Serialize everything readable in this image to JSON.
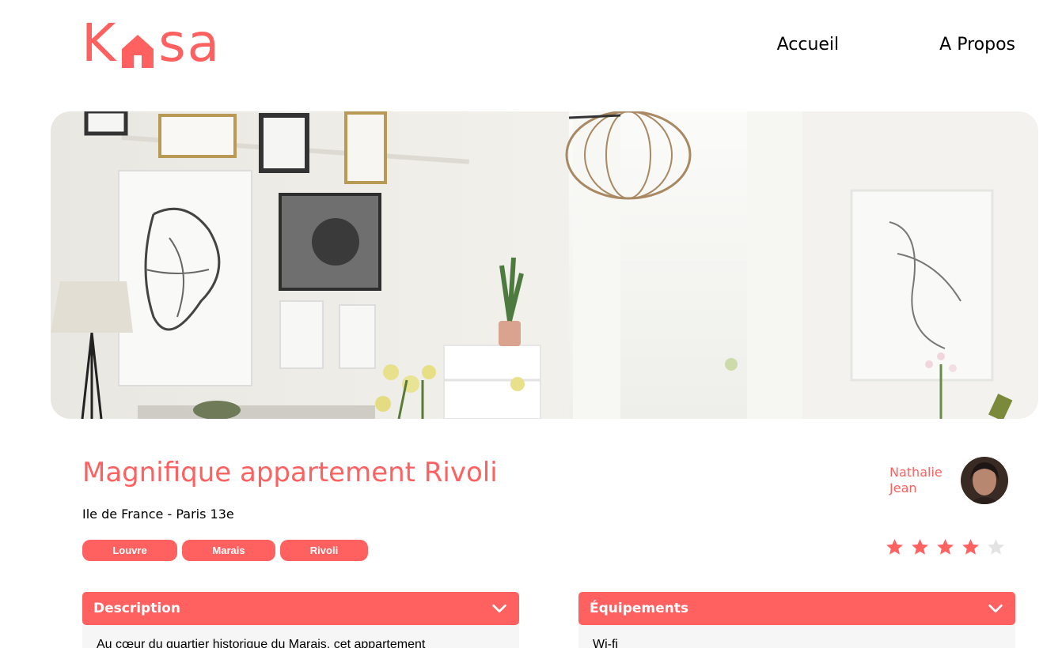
{
  "header": {
    "logo": {
      "letters_left": "K",
      "letters_right": "sa",
      "color": "#FF6060"
    },
    "nav": [
      {
        "label": "Accueil"
      },
      {
        "label": "A Propos"
      }
    ]
  },
  "listing": {
    "title": "Magnifique appartement Rivoli",
    "location": "Ile de France - Paris 13e",
    "tags": [
      "Louvre",
      "Marais",
      "Rivoli"
    ],
    "host": {
      "first_name": "Nathalie",
      "last_name": "Jean"
    },
    "rating": {
      "value": 4,
      "max": 5
    },
    "accent_color": "#FF6060",
    "inactive_star_color": "#E3E3E3"
  },
  "collapses": [
    {
      "title": "Description",
      "body": "Au cœur du quartier historique du Marais, cet appartement"
    },
    {
      "title": "Équipements",
      "body": "Wi-fi"
    }
  ]
}
